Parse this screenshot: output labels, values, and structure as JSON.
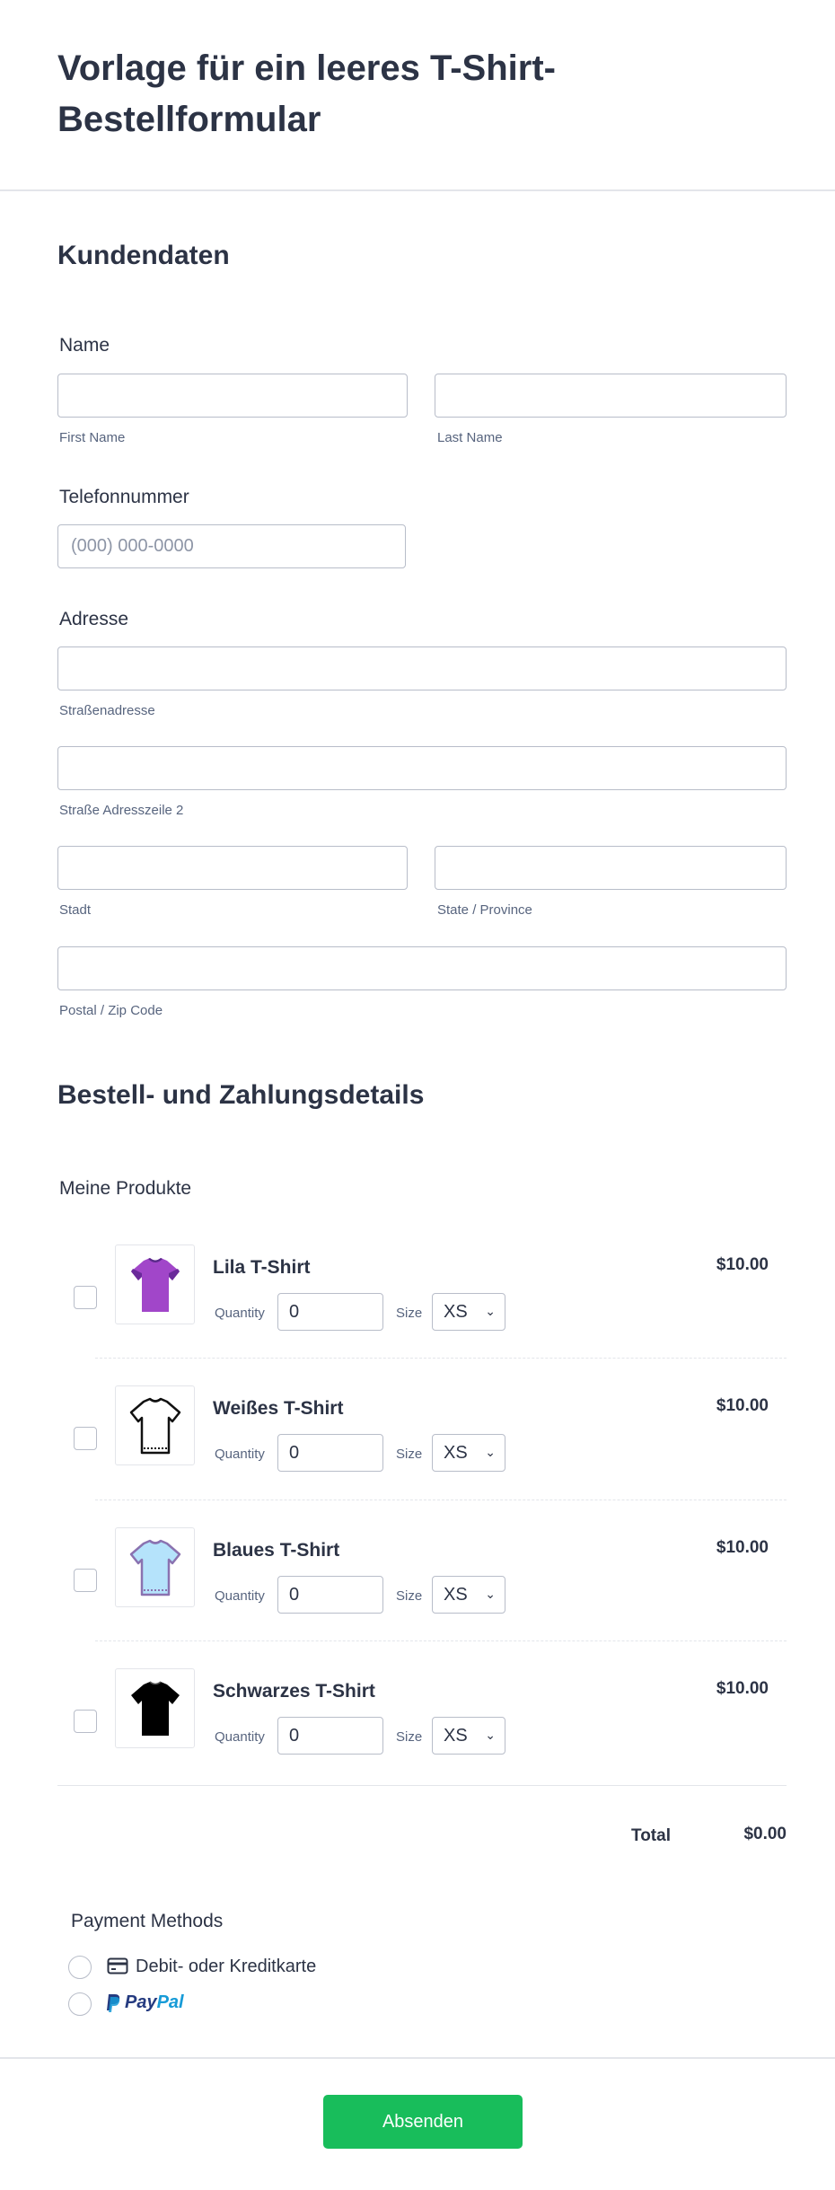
{
  "form": {
    "title": "Vorlage für ein leeres T-Shirt-Bestellformular"
  },
  "customer_section": {
    "title": "Kundendaten",
    "name": {
      "label": "Name",
      "first_value": "",
      "first_sublabel": "First Name",
      "last_value": "",
      "last_sublabel": "Last Name"
    },
    "phone": {
      "label": "Telefonnummer",
      "value": "",
      "placeholder": "(000) 000-0000"
    },
    "address": {
      "label": "Adresse",
      "street_value": "",
      "street_sublabel": "Straßenadresse",
      "street2_value": "",
      "street2_sublabel": "Straße Adresszeile 2",
      "city_value": "",
      "city_sublabel": "Stadt",
      "state_value": "",
      "state_sublabel": "State / Province",
      "zip_value": "",
      "zip_sublabel": "Postal / Zip Code"
    }
  },
  "order_section": {
    "title": "Bestell- und Zahlungsdetails",
    "products_label": "Meine Produkte",
    "quantity_label": "Quantity",
    "size_label": "Size",
    "products": [
      {
        "name": "Lila T-Shirt",
        "price": "$10.00",
        "quantity": "0",
        "size": "XS",
        "color": "#a146c9",
        "icon": "purple-tshirt-icon",
        "checked": false
      },
      {
        "name": "Weißes T-Shirt",
        "price": "$10.00",
        "quantity": "0",
        "size": "XS",
        "color": "#ffffff",
        "icon": "white-tshirt-icon",
        "checked": false
      },
      {
        "name": "Blaues T-Shirt",
        "price": "$10.00",
        "quantity": "0",
        "size": "XS",
        "color": "#b5e3fb",
        "icon": "blue-tshirt-icon",
        "checked": false
      },
      {
        "name": "Schwarzes T-Shirt",
        "price": "$10.00",
        "quantity": "0",
        "size": "XS",
        "color": "#000000",
        "icon": "black-tshirt-icon",
        "checked": false
      }
    ],
    "total_label": "Total",
    "total_value": "$0.00"
  },
  "payment": {
    "title": "Payment Methods",
    "options": [
      {
        "label": "Debit- oder Kreditkarte",
        "icon": "credit-card-icon",
        "selected": false
      },
      {
        "label_part1": "Pay",
        "label_part2": "Pal",
        "icon": "paypal-logo",
        "selected": false
      }
    ]
  },
  "footer": {
    "submit_label": "Absenden",
    "submit_color": "#18bd5b"
  }
}
